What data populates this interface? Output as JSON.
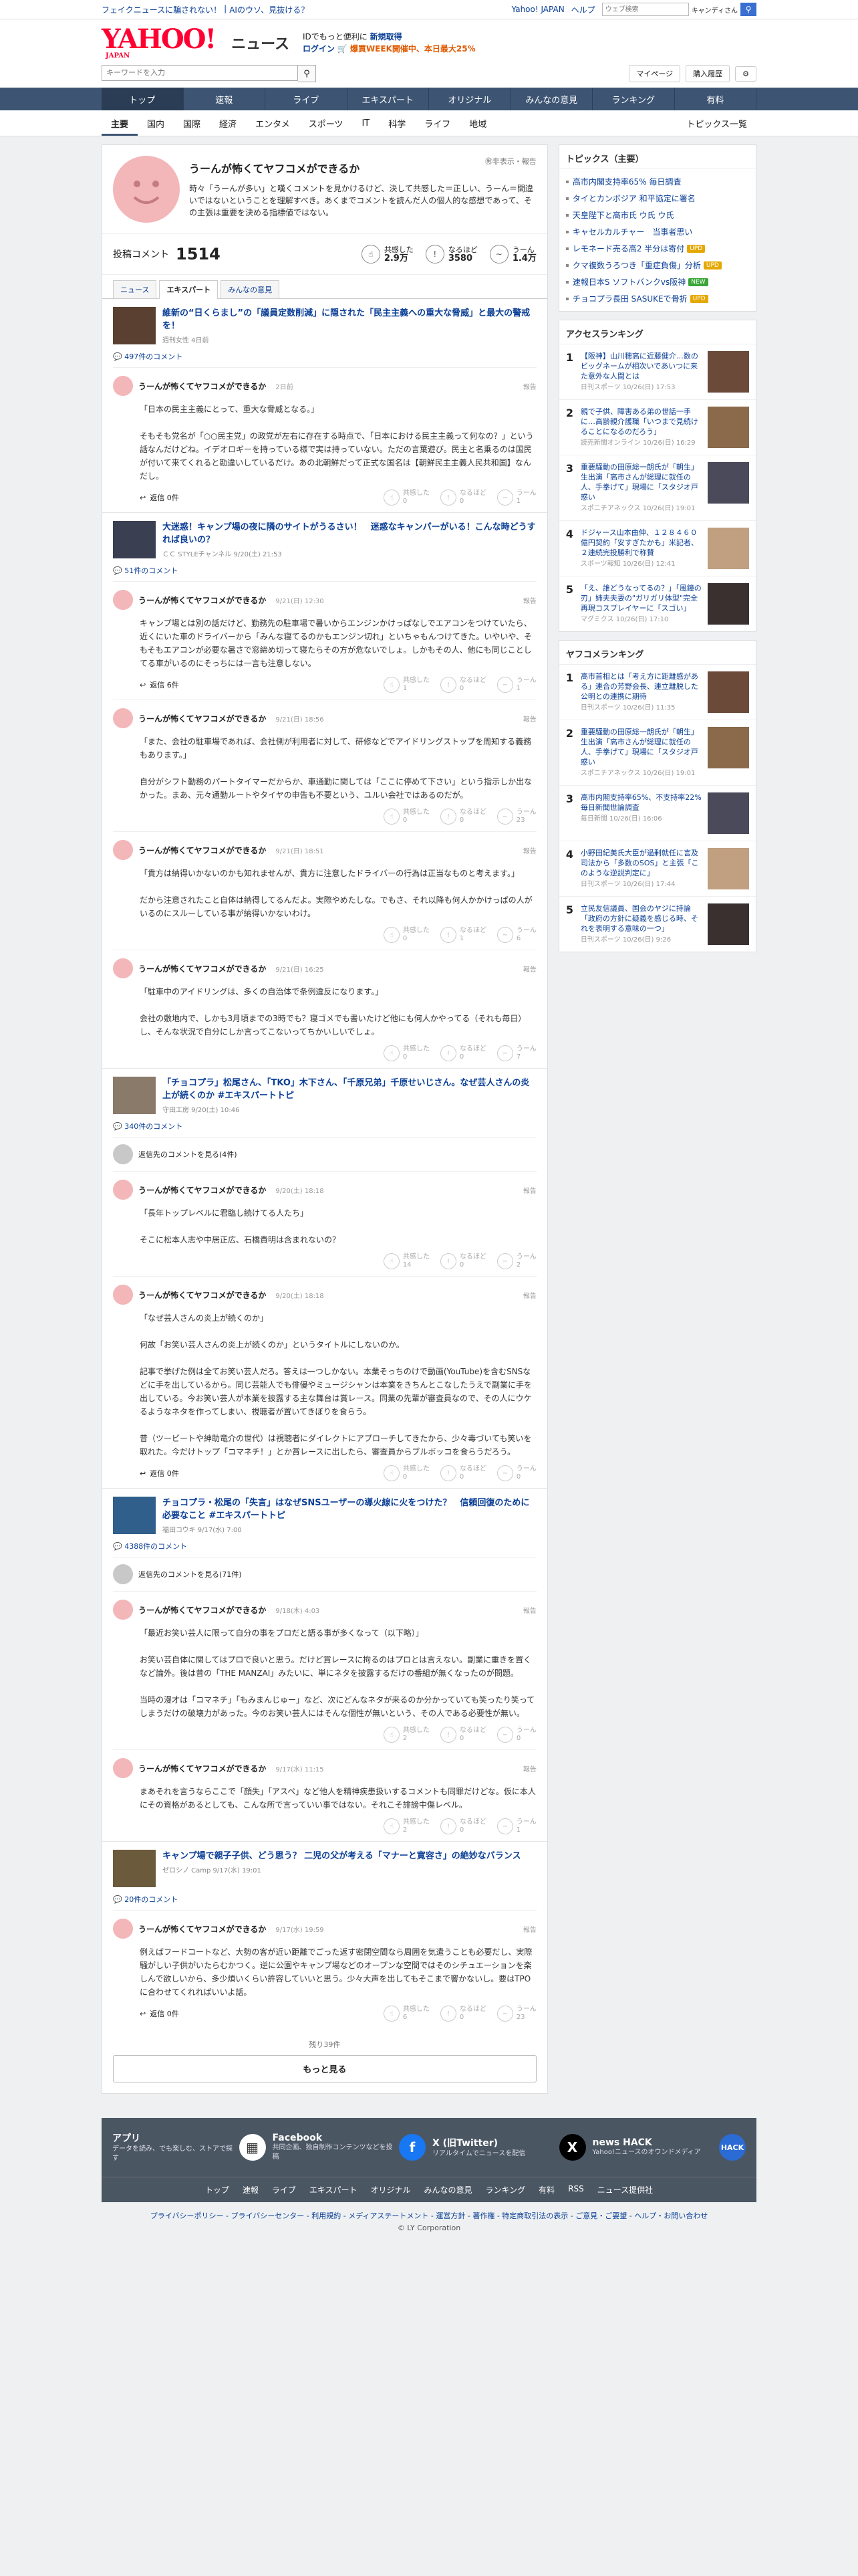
{
  "topbar": {
    "alerts": [
      "フェイクニュースに騙されない！",
      "AIのウソ、見抜ける？"
    ],
    "links": [
      "Yahoo! JAPAN",
      "ヘルプ"
    ],
    "search_placeholder": "ウェブ検索",
    "search_scope": "キャンディさん"
  },
  "header": {
    "logo": "YAHOO!",
    "logo_sub": "JAPAN",
    "logo_news": "ニュース",
    "promo_line1": "IDでもっと便利に",
    "promo_line1_link": "新規取得",
    "promo_login": "ログイン",
    "promo_line2": "🛒 爆買WEEK開催中、本日最大25%"
  },
  "searchbar": {
    "placeholder": "キーワードを入力",
    "mypage": "マイページ",
    "history": "購入履歴"
  },
  "gnav": [
    {
      "label": "トップ",
      "active": true
    },
    {
      "label": "速報",
      "active": false
    },
    {
      "label": "ライブ",
      "active": false
    },
    {
      "label": "エキスパート",
      "active": false
    },
    {
      "label": "オリジナル",
      "active": false
    },
    {
      "label": "みんなの意見",
      "active": false
    },
    {
      "label": "ランキング",
      "active": false
    },
    {
      "label": "有料",
      "active": false
    }
  ],
  "subnav": {
    "items": [
      "主要",
      "国内",
      "国際",
      "経済",
      "エンタメ",
      "スポーツ",
      "IT",
      "科学",
      "ライフ",
      "地域"
    ],
    "right": "トピックス一覧"
  },
  "profile": {
    "name": "うーんが怖くてヤフコメができるか",
    "desc": "時々「うーんが多い」と嘆くコメントを見かけるけど、決して共感した＝正しい、うーん＝間違いではないということを理解すべき。あくまでコメントを読んだ人の個人的な感想であって、その主張は重要を決める指標値ではない。",
    "registered": "㊚非表示・報告"
  },
  "stats": {
    "label": "投稿コメント",
    "count": "1514",
    "empathy_label": "共感した",
    "empathy": "2.9万",
    "naruhodo_label": "なるほど",
    "naruhodo": "3580",
    "uun_label": "うーん",
    "uun": "1.4万"
  },
  "tabs": [
    "ニュース",
    "エキスパート",
    "みんなの意見"
  ],
  "articles": [
    {
      "title": "維新の“日くらまし”の「議員定数削減」に隠された「民主主義への重大な脅威」と最大の警戒を！",
      "meta": "週刊女性 4日前",
      "ccount": "497件のコメント",
      "comments": [
        {
          "name": "うーんが怖くてヤフコメができるか",
          "date": "2日前",
          "body": "「日本の民主主義にとって、重大な脅威となる。」\n\nそもそも党名が「○○民主党」の政党が左右に存在する時点で、「日本における民主主義って何なの？」という話なんだけどね。イデオロギーを持っている様で実は持っていない。ただの言葉遊び。民主と名乗るのは国民が付いて来てくれると勘違いしているだけ。あの北朝鮮だって正式な国名は【朝鮮民主主義人民共和国】なんだし。",
          "reply": "返信 0件",
          "e": "0",
          "n": "0",
          "u": "1"
        }
      ]
    },
    {
      "title": "大迷惑！キャンプ場の夜に隣のサイトがうるさい！　迷惑なキャンパーがいる！こんな時どうすれば良いの？",
      "meta": "ＣＣ STYLEチャンネル 9/20(土) 21:53",
      "ccount": "51件のコメント",
      "comments": [
        {
          "name": "うーんが怖くてヤフコメができるか",
          "date": "9/21(日) 12:30",
          "body": "キャンプ場とは別の話だけど、勤務先の駐車場で暑いからエンジンかけっぱなしでエアコンをつけていたら、近くにいた車のドライバーから「みんな寝てるのかもエンジン切れ」といちゃもんつけてきた。いやいや、そもそもエアコンが必要な暑さで窓締め切って寝たらその方が危ないでしょ。しかもその人、他にも同じことしてる車がいるのにそっちには一言も注意しない。",
          "reply": "返信 6件",
          "e": "1",
          "n": "0",
          "u": "1"
        },
        {
          "name": "うーんが怖くてヤフコメができるか",
          "date": "9/21(日) 18:56",
          "body": "「また、会社の駐車場であれば、会社側が利用者に対して、研修などでアイドリングストップを周知する義務もあります。」\n\n自分がシフト勤務のパートタイマーだからか、車通勤に関しては「ここに停めて下さい」という指示しか出なかった。まあ、元々通勤ルートやタイヤの申告も不要という、ユルい会社ではあるのだが。",
          "reply": "",
          "e": "0",
          "n": "0",
          "u": "23"
        },
        {
          "name": "うーんが怖くてヤフコメができるか",
          "date": "9/21(日) 18:51",
          "body": "「貴方は納得いかないのかも知れませんが、貴方に注意したドライバーの行為は正当なものと考えます。」\n\nだから注意されたこと自体は納得してるんだよ。実際やめたしな。でもさ、それ以降も何人かかけっぱの人がいるのにスルーしている事が納得いかないわけ。",
          "reply": "",
          "e": "0",
          "n": "1",
          "u": "6"
        },
        {
          "name": "うーんが怖くてヤフコメができるか",
          "date": "9/21(日) 16:25",
          "body": "「駐車中のアイドリングは、多くの自治体で条例違反になります。」\n\n会社の敷地内で、しかも3月頃までの3時でも？寝ゴメでも書いたけど他にも何人かやってる（それも毎日）し、そんな状況で自分にしか言ってこないってちかいしいでしょ。",
          "reply": "",
          "e": "0",
          "n": "0",
          "u": "7"
        }
      ]
    },
    {
      "title": "「チョコプラ」松尾さん、「TKO」木下さん、「千原兄弟」千原せいじさん。なぜ芸人さんの炎上が続くのか #エキスパートトピ",
      "meta": "守田工房 9/20(土) 10:46",
      "ccount": "340件のコメント",
      "seemore": "返信先のコメントを見る(4件)",
      "comments": [
        {
          "name": "うーんが怖くてヤフコメができるか",
          "date": "9/20(土) 18:18",
          "body": "「長年トップレベルに君臨し続けてる人たち」\n\nそこに松本人志や中居正広、石橋貴明は含まれないの？",
          "reply": "",
          "e": "14",
          "n": "0",
          "u": "2"
        },
        {
          "name": "うーんが怖くてヤフコメができるか",
          "date": "9/20(土) 18:18",
          "body": "「なぜ芸人さんの炎上が続くのか」\n\n何故「お笑い芸人さんの炎上が続くのか」というタイトルにしないのか。\n\n記事で挙げた例は全てお笑い芸人だろ。答えは一つしかない。本業そっちのけで動画(YouTube)を含むSNSなどに手を出しているから。同じ芸能人でも俳優やミュージシャンは本業をきちんとこなしたうえで副業に手を出している。今お笑い芸人が本業を披露する主な舞台は賞レース。同業の先輩が審査員なので、その人にウケるようなネタを作ってしまい、視聴者が置いてきぼりを食らう。\n\n昔（ツービートや紳助竜介の世代）は視聴者にダイレクトにアプローチしてきたから、少々毒づいても笑いを取れた。今だけトップ「コマネチ！」とか賞レースに出したら、審査員からブルボッコを食らうだろう。",
          "reply": "返信 0件",
          "e": "0",
          "n": "0",
          "u": "0"
        }
      ]
    },
    {
      "title": "チョコプラ・松尾の「失言」はなぜSNSユーザーの導火線に火をつけた？　信頼回復のために必要なこと #エキスパートトピ",
      "meta": "福田コウキ 9/17(水) 7:00",
      "ccount": "4388件のコメント",
      "seemore": "返信先のコメントを見る(71件)",
      "comments": [
        {
          "name": "うーんが怖くてヤフコメができるか",
          "date": "9/18(木) 4:03",
          "body": "「最近お笑い芸人に限って自分の事をプロだと語る事が多くなって（以下略）」\n\nお笑い芸自体に関してはプロで良いと思う。だけど賞レースに拘るのはプロとは言えない。副業に重きを置くなど論外。後は昔の「THE MANZAI」みたいに、単にネタを披露するだけの番組が無くなったのが問題。\n\n当時の漫才は「コマネチ」「もみまんじゅー」など、次にどんなネタが来るのか分かっていても笑ったり笑ってしまうだけの破壊力があった。今のお笑い芸人にはそんな個性が無いという、その人である必要性が無い。",
          "reply": "",
          "e": "2",
          "n": "0",
          "u": "0"
        },
        {
          "name": "うーんが怖くてヤフコメができるか",
          "date": "9/17(水) 11:15",
          "body": "まあそれを言うならここで「顔失」「アスペ」など他人を精神疾患扱いするコメントも同罪だけどな。仮に本人にその資格があるとしても、こんな所で言っていい事ではない。それこそ誹謗中傷レベル。",
          "reply": "",
          "e": "2",
          "n": "0",
          "u": "1"
        }
      ]
    },
    {
      "title": "キャンプ場で親子子供、どう思う？ 二児の父が考える「マナーと寛容さ」の絶妙なバランス",
      "meta": "ゼロシノ Camp 9/17(水) 19:01",
      "ccount": "20件のコメント",
      "comments": [
        {
          "name": "うーんが怖くてヤフコメができるか",
          "date": "9/17(水) 19:59",
          "body": "例えばフードコートなど、大勢の客が近い距離でごった返す密閉空間なら周囲を気遣うことも必要だし、実際騒がしい子供がいたらむかつく。逆に公園やキャンプ場などのオープンな空間ではそのシチュエーションを楽しんで欲しいから、多少煩いくらい許容していいと思う。少々大声を出してもそこまで響かないし。要はTPOに合わせてくれればいいよ話。",
          "reply": "返信 0件",
          "e": "6",
          "n": "0",
          "u": "23"
        }
      ]
    }
  ],
  "footer_main": {
    "remaining": "残り39件",
    "more": "もっと見る"
  },
  "side": {
    "topics_title": "トピックス（主要）",
    "topics": [
      {
        "text": "高市内閣支持率65% 毎日調査",
        "badge": ""
      },
      {
        "text": "タイとカンボジア 和平協定に署名",
        "badge": ""
      },
      {
        "text": "天皇陛下と高市氏 ウ氏 ウ氏",
        "badge": ""
      },
      {
        "text": "キャセルカルチャー　当事者思い",
        "badge": ""
      },
      {
        "text": "レモネード売る高2 半分は寄付",
        "badge": "upd"
      },
      {
        "text": "クマ複数うろつき「重症負傷」分析",
        "badge": "upd"
      },
      {
        "text": "速報日本S ソフトバンクvs阪神",
        "badge": "new"
      },
      {
        "text": "チョコプラ長田 SASUKEで骨折",
        "badge": "upd"
      }
    ],
    "access_title": "アクセスランキング",
    "access": [
      {
        "n": "1",
        "t": "【阪神】山川穂高に近藤健介…数のビッグネームが相次いであいつに来た意外な人間とは",
        "s": "日刊スポーツ 10/26(日) 17:53"
      },
      {
        "n": "2",
        "t": "親で子供、障害ある弟の世話一手に…高齢親介護職「いつまで見続けることになるのだろう」",
        "s": "読売新聞オンライン 10/26(日) 16:29"
      },
      {
        "n": "3",
        "t": "重要騒動の田原総一朗氏が「朝生」生出演「高市さんが総理に就任の人、手拳げて」現場に「スタジオ戸惑い",
        "s": "スポニチアネックス 10/26(日) 19:01"
      },
      {
        "n": "4",
        "t": "ドジャース山本由伸、１２８４６０億円契約「安すぎたかも」米記者、２連続完投勝利で称賛",
        "s": "スポーツ報知 10/26(日) 12:41"
      },
      {
        "n": "5",
        "t": "「え、誰どうなってるの？」「風鐘の刃」姉夫夫妻の\"ガリガリ体型\"完全再現コスプレイヤーに「スゴい」",
        "s": "マグミクス 10/26(日) 17:10"
      }
    ],
    "yafcom_title": "ヤフコメランキング",
    "yafcom": [
      {
        "n": "1",
        "t": "高市首相とは「考え方に距離感がある」連合の芳野会長、連立離脱した公明との連携に期待",
        "s": "日刊スポーツ 10/26(日) 11:35"
      },
      {
        "n": "2",
        "t": "重要騒動の田原総一朗氏が「朝生」生出演「高市さんが総理に就任の人、手拳げて」現場に「スタジオ戸惑い",
        "s": "スポニチアネックス 10/26(日) 19:01"
      },
      {
        "n": "3",
        "t": "高市内閣支持率65%、不支持率22%　毎日新聞世論調査",
        "s": "毎日新聞 10/26(日) 16:06"
      },
      {
        "n": "4",
        "t": "小野田紀美氏大臣が過剰就任に言及　司法から「多数のSOS」と主張「このような逆説判定に」",
        "s": "日刊スポーツ 10/26(日) 17:44"
      },
      {
        "n": "5",
        "t": "立民友信議員、国会のヤジに持論「政府の方針に疑義を感じる時、それを表明する意味の一つ」",
        "s": "日刊スポーツ 10/26(日) 9:26"
      }
    ]
  },
  "apps": [
    {
      "h": "アプリ",
      "d": "データを読み、でも楽しむ、ストアで探す",
      "icon": "📰",
      "color": "#ffffff"
    },
    {
      "h": "Facebook",
      "d": "共同企画、独自制作コンテンツなどを投稿",
      "icon": "f",
      "color": "#1877f2"
    },
    {
      "h": "X (旧Twitter)",
      "d": "リアルタイムでニュースを配信",
      "icon": "𝕏",
      "color": "#000000"
    },
    {
      "h": "news HACK",
      "d": "Yahoo!ニュースのオウンドメディア",
      "icon": "H",
      "color": "#2b6bd4"
    }
  ],
  "fnav": [
    "トップ",
    "速報",
    "ライブ",
    "エキスパート",
    "オリジナル",
    "みんなの意見",
    "ランキング",
    "有料",
    "RSS",
    "ニュース提供社"
  ],
  "flinks": "プライバシーポリシー - プライバシーセンター - 利用規約 - メディアステートメント - 運営方針 - 著作権 - 特定商取引法の表示 - ご意見・ご要望 - ヘルプ・お問い合わせ",
  "copyright": "© LY Corporation"
}
